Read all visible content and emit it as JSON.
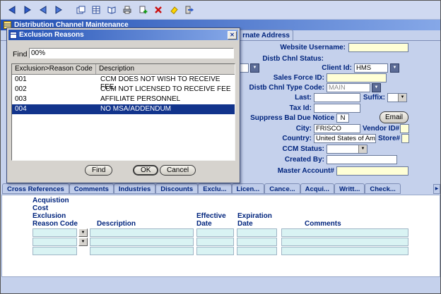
{
  "colors": {
    "titlebar_start": "#2250b4",
    "titlebar_end": "#86a8e8",
    "selection": "#12348c",
    "label_navy": "#00247d",
    "canvas": "#c5d1ec",
    "field_yellow": "#ffffd6",
    "field_cyan": "#d9f3f3"
  },
  "toolbar": {
    "icons": [
      "nav-first",
      "nav-prev",
      "nav-next",
      "nav-last",
      "new-form",
      "forms-grid",
      "ledger",
      "print",
      "add-record",
      "delete-record",
      "clear-form",
      "exit"
    ]
  },
  "window": {
    "title": "Distribution Channel Maintenance"
  },
  "dialog": {
    "title": "Exclusion Reasons",
    "find_label": "Find",
    "find_value": "00%",
    "list": {
      "columns": [
        "Exclusion>Reason Code",
        "Description"
      ],
      "rows": [
        {
          "code": "001",
          "description": "CCM DOES NOT WISH TO RECEIVE FEE",
          "selected": false
        },
        {
          "code": "002",
          "description": "CCM NOT LICENSED TO RECEIVE FEE",
          "selected": false
        },
        {
          "code": "003",
          "description": "AFFILIATE PERSONNEL",
          "selected": false
        },
        {
          "code": "004",
          "description": "NO MSA/ADDENDUM",
          "selected": true
        }
      ]
    },
    "buttons": {
      "find": "Find",
      "ok": "OK",
      "cancel": "Cancel"
    }
  },
  "form": {
    "tab_partial": "rnate Address",
    "fields": {
      "website_username_label": "Website Username:",
      "distb_chnl_status_label": "Distb Chnl Status:",
      "client_id_label": "Client Id:",
      "client_id_value": "HMS",
      "sales_force_id_label": "Sales Force ID:",
      "distb_chnl_type_code_label": "Distb Chnl Type Code:",
      "distb_chnl_type_code_value": "MAIN",
      "last_label": "Last:",
      "suffix_label": "Suffix:",
      "tax_id_label": "Tax Id:",
      "suppress_label": "Suppress Bal Due Notice",
      "suppress_value": "N",
      "email_button": "Email",
      "city_label": "City:",
      "city_value": "FRISCO",
      "vendor_id_label": "Vendor ID#",
      "country_label": "Country:",
      "country_value": "United States of Ame",
      "store_label": "Store#",
      "ccm_status_label": "CCM Status:",
      "created_by_label": "Created By:",
      "master_account_label": "Master Account#"
    }
  },
  "tabs": {
    "items": [
      "Cross References",
      "Comments",
      "Industries",
      "Discounts",
      "Exclu...",
      "Licen...",
      "Cance...",
      "Acqui...",
      "Writt...",
      "Check..."
    ]
  },
  "grid": {
    "header": {
      "col1_lines": [
        "Acquistion",
        "Cost",
        "Exclusion",
        "Reason Code"
      ],
      "description": "Description",
      "effective": [
        "Effective",
        "Date"
      ],
      "expiration": [
        "Expiration",
        "Date"
      ],
      "comments": "Comments"
    }
  }
}
